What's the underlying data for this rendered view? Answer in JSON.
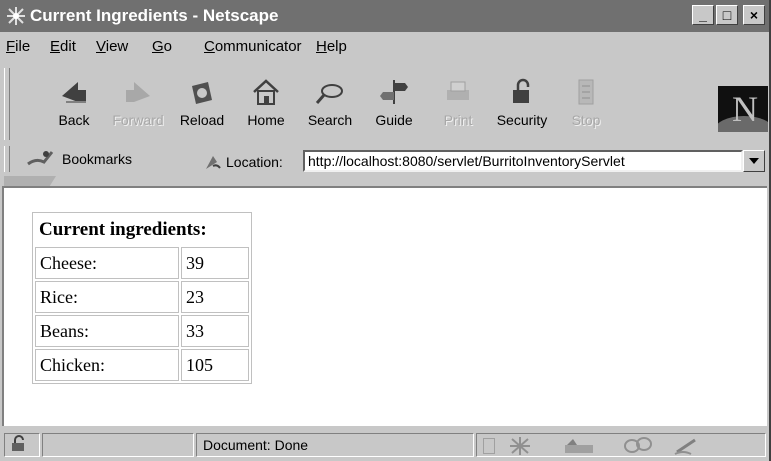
{
  "window": {
    "title": "Current Ingredients - Netscape",
    "controls": [
      "_",
      "□",
      "×"
    ]
  },
  "menubar": {
    "items": [
      {
        "key": "F",
        "rest": "ile"
      },
      {
        "key": "E",
        "rest": "dit"
      },
      {
        "key": "V",
        "rest": "iew"
      },
      {
        "key": "G",
        "rest": "o"
      },
      {
        "key": "C",
        "rest": "ommunicator"
      },
      {
        "key": "H",
        "rest": "elp"
      }
    ]
  },
  "toolbar": {
    "buttons": [
      {
        "label": "Back",
        "icon": "back-arrow-icon",
        "enabled": true
      },
      {
        "label": "Forward",
        "icon": "forward-arrow-icon",
        "enabled": false
      },
      {
        "label": "Reload",
        "icon": "reload-icon",
        "enabled": true
      },
      {
        "label": "Home",
        "icon": "home-icon",
        "enabled": true
      },
      {
        "label": "Search",
        "icon": "search-icon",
        "enabled": true
      },
      {
        "label": "Guide",
        "icon": "guide-icon",
        "enabled": true
      },
      {
        "label": "Print",
        "icon": "print-icon",
        "enabled": false
      },
      {
        "label": "Security",
        "icon": "security-lock-icon",
        "enabled": true
      },
      {
        "label": "Stop",
        "icon": "stop-icon",
        "enabled": false
      }
    ]
  },
  "location": {
    "bookmarks_label": "Bookmarks",
    "location_label": "Location:",
    "url": "http://localhost:8080/servlet/BurritoInventoryServlet"
  },
  "page": {
    "heading": "Current ingredients:",
    "rows": [
      {
        "name": "Cheese:",
        "value": "39"
      },
      {
        "name": "Rice:",
        "value": "23"
      },
      {
        "name": "Beans:",
        "value": "33"
      },
      {
        "name": "Chicken:",
        "value": "105"
      }
    ]
  },
  "status": {
    "text": "Document: Done"
  },
  "colors": {
    "chrome": "#c8c8c8",
    "titlebar": "#707070",
    "page_bg": "#ffffff"
  }
}
